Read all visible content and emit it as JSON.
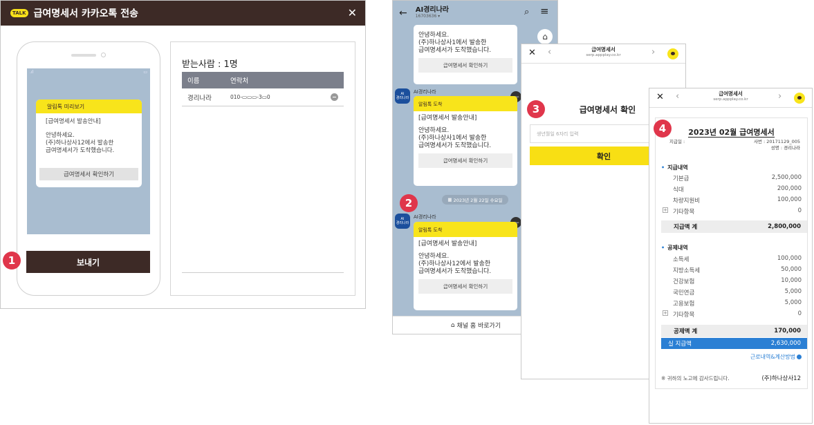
{
  "dialog": {
    "talk_logo": "TALK",
    "title": "급여명세서 카카오톡 전송",
    "close": "✕",
    "preview": {
      "header": "알림톡 미리보기",
      "heading": "[급여명세서 발송안내]",
      "greeting": "안녕하세요.",
      "line1": "(주)하나상사12에서 발송한",
      "line2": "급여명세서가 도착했습니다.",
      "button": "급여명세서 확인하기"
    },
    "send_button": "보내기",
    "recipients": {
      "title": "받는사람 : 1명",
      "col_name": "이름",
      "col_phone": "연락처",
      "rows": [
        {
          "name": "경리나라",
          "phone": "010-▭▭▭-3▭0"
        }
      ]
    }
  },
  "chat": {
    "back": "←",
    "name": "AI경리나라",
    "id": "16703636 ▾",
    "messages": [
      {
        "lines": [
          "안녕하세요.",
          "(주)하나상사1에서 발송한",
          "급여명세서가 도착했습니다."
        ],
        "button": "급여명세서 확인하기"
      },
      {
        "sender": "AI경리나라",
        "header": "알림톡 도착",
        "heading": "[급여명세서 발송안내]",
        "lines": [
          "안녕하세요.",
          "(주)하나상사1에서 발송한",
          "급여명세서가 도착했습니다."
        ],
        "button": "급여명세서 확인하기"
      },
      {
        "sender": "AI경리나라",
        "header": "알림톡 도착",
        "heading": "[급여명세서 발송안내]",
        "lines": [
          "안녕하세요.",
          "(주)하나상사12에서 발송한",
          "급여명세서가 도착했습니다."
        ],
        "button": "급여명세서 확인하기"
      }
    ],
    "avatar_top": "AI",
    "avatar_bottom": "경리나라",
    "kakao_badge": "kakao",
    "date": "2023년 2월 22일 수요일",
    "home_link": "채널 홈 바로가기"
  },
  "verify": {
    "page_title": "급여명세서",
    "url": "serp.appplay.co.kr",
    "heading": "급여명세서 확인",
    "placeholder": "생년월일 6자리 입력",
    "button": "확인"
  },
  "slip": {
    "page_title": "급여명세서",
    "url": "serp.appplay.co.kr",
    "title": "2023년 02월 급여명세서",
    "pay_date_label": "지급일 :",
    "emp_no": "사번 : 20171129_005",
    "emp_name": "성명 : 경리나라",
    "earnings_title": "지급내역",
    "earnings": [
      {
        "label": "기본급",
        "value": "2,500,000"
      },
      {
        "label": "식대",
        "value": "200,000"
      },
      {
        "label": "차량지원비",
        "value": "100,000"
      },
      {
        "label": "기타항목",
        "value": "0"
      }
    ],
    "earnings_total_label": "지급액 계",
    "earnings_total": "2,800,000",
    "deductions_title": "공제내역",
    "deductions": [
      {
        "label": "소득세",
        "value": "100,000"
      },
      {
        "label": "지방소득세",
        "value": "50,000"
      },
      {
        "label": "건강보험",
        "value": "10,000"
      },
      {
        "label": "국민연금",
        "value": "5,000"
      },
      {
        "label": "고용보험",
        "value": "5,000"
      },
      {
        "label": "기타항목",
        "value": "0"
      }
    ],
    "deductions_total_label": "공제액 계",
    "deductions_total": "170,000",
    "net_label": "실 지급액",
    "net_value": "2,630,000",
    "calc_link": "근로내역&계산방법",
    "thanks": "※ 귀하의 노고에 감사드립니다.",
    "company": "(주)하나상사12"
  },
  "badges": [
    "1",
    "2",
    "3",
    "4"
  ],
  "colors": {
    "kakao_yellow": "#f8e41b",
    "dark_brown": "#3d2a26",
    "badge_red": "#e0364b",
    "accent_blue": "#2a7fd4"
  }
}
